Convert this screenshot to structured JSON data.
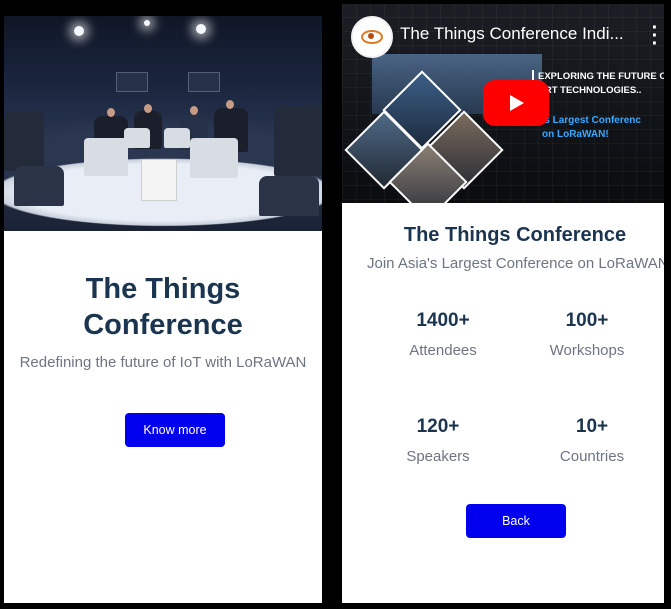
{
  "left_card": {
    "title": "The Things Conference",
    "subtitle": "Redefining the future of IoT with LoRaWAN",
    "button_label": "Know more"
  },
  "right_card": {
    "video": {
      "title": "The Things Conference Indi...",
      "headline_line1": "EXPLORING THE FUTURE OF",
      "headline_line2": "ART TECHNOLOGIES..",
      "tagline_line1": "sia's Largest Conferenc",
      "tagline_line2": "on LoRaWAN!",
      "channel_logo_text": "Eyeris",
      "menu_icon": "more-vert-icon",
      "play_icon": "youtube-play-icon"
    },
    "title": "The Things Conference",
    "subtitle": "Join Asia's Largest Conference on LoRaWAN",
    "stats": [
      {
        "value": "1400+",
        "label": "Attendees"
      },
      {
        "value": "100+",
        "label": "Workshops"
      },
      {
        "value": "120+",
        "label": "Speakers"
      },
      {
        "value": "10+",
        "label": "Countries"
      }
    ],
    "button_label": "Back"
  },
  "colors": {
    "accent_button": "#0000ee",
    "heading": "#1b3550",
    "body_text": "#6d7582",
    "page_background": "#000000",
    "youtube_red": "#ff0000"
  }
}
